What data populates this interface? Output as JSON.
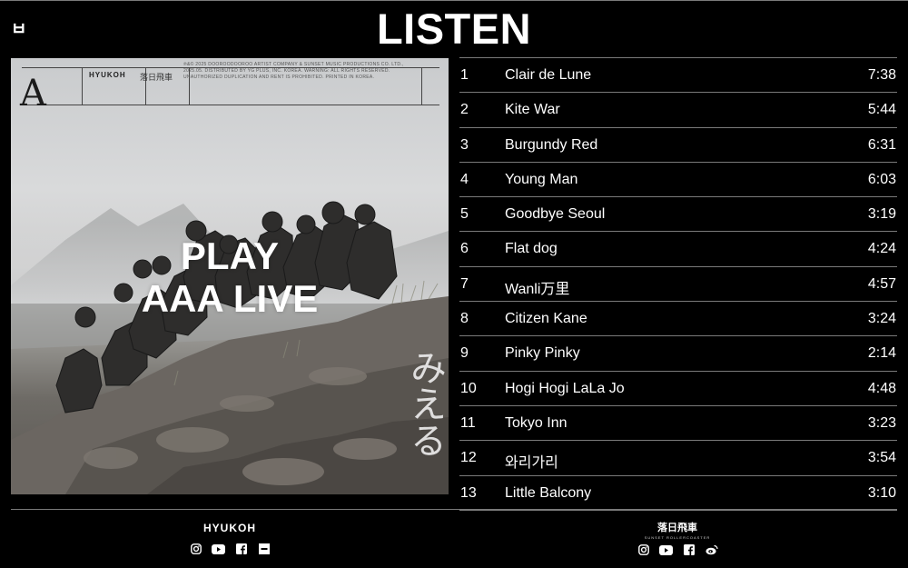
{
  "header": {
    "logo": "ㅂ",
    "title": "LISTEN"
  },
  "album": {
    "overlay_line1": "PLAY",
    "overlay_line2": "AAA LIVE",
    "cover_brand": "HYUKOH",
    "cover_brand2": "落日飛車",
    "cover_copyright": "℗&© 2025 DOOROODOOROO ARTIST COMPANY & SUNSET MUSIC PRODUCTIONS CO. LTD., 2025.05. DISTRIBUTED BY YG PLUS, INC. KOREA. WARNING: ALL RIGHTS RESERVED. UNAUTHORIZED DUPLICATION AND RENT IS PROHIBITED. PRINTED IN KOREA.",
    "cover_glyph": "A",
    "cover_calligraphy": "みえる"
  },
  "tracks": [
    {
      "number": "1",
      "title": "Clair de Lune",
      "duration": "7:38"
    },
    {
      "number": "2",
      "title": "Kite War",
      "duration": "5:44"
    },
    {
      "number": "3",
      "title": "Burgundy Red",
      "duration": "6:31"
    },
    {
      "number": "4",
      "title": "Young Man",
      "duration": "6:03"
    },
    {
      "number": "5",
      "title": "Goodbye Seoul",
      "duration": "3:19"
    },
    {
      "number": "6",
      "title": "Flat dog",
      "duration": "4:24"
    },
    {
      "number": "7",
      "title": "Wanli万里",
      "duration": "4:57"
    },
    {
      "number": "8",
      "title": "Citizen Kane",
      "duration": "3:24"
    },
    {
      "number": "9",
      "title": "Pinky Pinky",
      "duration": "2:14"
    },
    {
      "number": "10",
      "title": "Hogi Hogi LaLa Jo",
      "duration": "4:48"
    },
    {
      "number": "11",
      "title": "Tokyo Inn",
      "duration": "3:23"
    },
    {
      "number": "12",
      "title": "와리가리",
      "duration": "3:54"
    },
    {
      "number": "13",
      "title": "Little Balcony",
      "duration": "3:10"
    }
  ],
  "footer": {
    "left": {
      "brand": "HYUKOH",
      "icons": [
        "instagram-icon",
        "youtube-icon",
        "facebook-icon",
        "adr-icon"
      ]
    },
    "right": {
      "brand": "落日飛車",
      "sub": "SUNSET ROLLERCOASTER",
      "icons": [
        "instagram-icon",
        "youtube-icon",
        "facebook-icon",
        "weibo-icon"
      ]
    }
  },
  "colors": {
    "background": "#000000",
    "text": "#ffffff",
    "rule": "#7a7a7a"
  }
}
